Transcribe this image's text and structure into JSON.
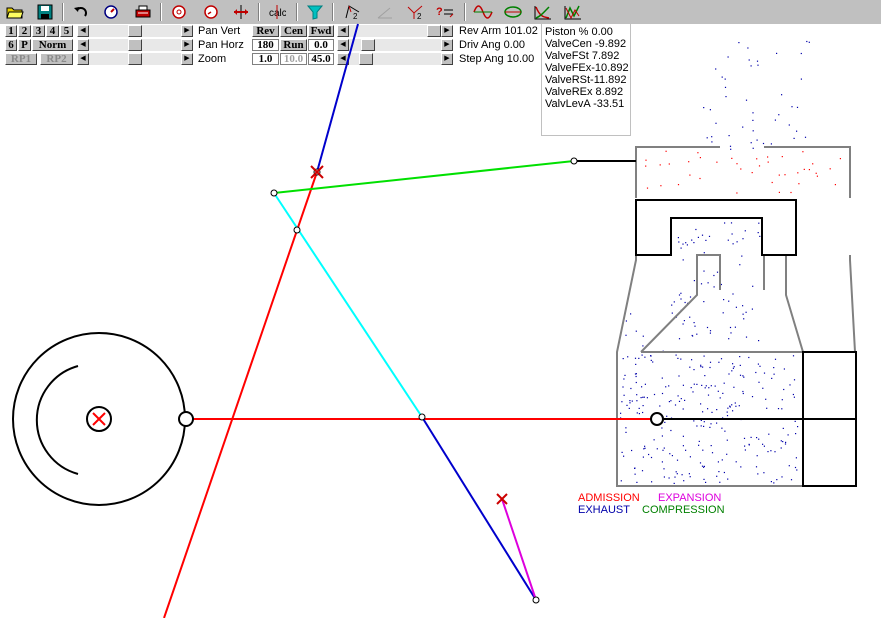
{
  "toolbar": {
    "icons": [
      "open-folder-icon",
      "save-disk-icon",
      "undo-icon",
      "step-dial-icon",
      "print-icon",
      "rotate-cw-icon",
      "rotate-ccw-icon",
      "move-icon",
      "calc-icon",
      "funnel-icon",
      "pivot-icon",
      "angle-icon",
      "vector-icon",
      "help-icon",
      "sine-wave-icon",
      "ellipse-icon",
      "graph-icon",
      "graph-alt-icon"
    ]
  },
  "controls": {
    "row1_buttons": [
      "1",
      "2",
      "3",
      "4",
      "5"
    ],
    "row2_buttons": [
      "6",
      "P",
      "Norm"
    ],
    "row3_buttons": [
      "RP1",
      "RP2"
    ],
    "pan_vert_label": "Pan Vert",
    "pan_horz_label": "Pan Horz",
    "zoom_label": "Zoom",
    "rev_label": "Rev",
    "cen_label": "Cen",
    "fwd_label": "Fwd",
    "run_value": "180",
    "run_label": "Run",
    "run_offset": "0.0",
    "zoom_min": "1.0",
    "zoom_mid": "10.0",
    "zoom_value": "45.0",
    "rev_arm": "Rev Arm 101.02",
    "driv_ang": "Driv Ang  0.00",
    "step_ang": "Step Ang 10.00"
  },
  "readouts": [
    "Piston %  0.00",
    "ValveCen -9.892",
    "ValveFSt  7.892",
    "ValveFEx-10.892",
    "ValveRSt-11.892",
    "ValveREx  8.892",
    "ValvLevA -33.51"
  ],
  "legend": {
    "admission": "ADMISSION",
    "expansion": "EXPANSION",
    "exhaust": "EXHAUST",
    "compression": "COMPRESSION"
  },
  "colors": {
    "admission": "#ff0000",
    "expansion": "#ff00ff",
    "exhaust": "#0000aa",
    "compression": "#008000",
    "eccentric_rod": "#00ffff",
    "reach_rod": "#00e000",
    "radius_rod": "#0000ff",
    "link": "#cc00cc"
  }
}
